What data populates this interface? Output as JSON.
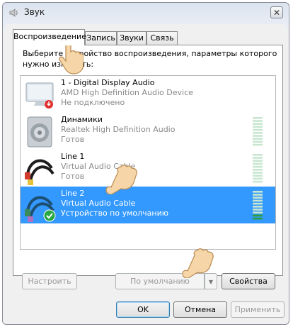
{
  "window": {
    "title": "Звук",
    "close_glyph": "✕"
  },
  "tabs": [
    {
      "label": "Воспроизведение",
      "active": true
    },
    {
      "label": "Запись",
      "active": false
    },
    {
      "label": "Звуки",
      "active": false
    },
    {
      "label": "Связь",
      "active": false
    }
  ],
  "description": "Выберите устройство воспроизведения, параметры которого нужно изменить:",
  "devices": [
    {
      "name": "1 - Digital Display Audio",
      "driver": "AMD High Definition Audio Device",
      "status": "Не подключено",
      "icon": "monitor-icon",
      "selected": false
    },
    {
      "name": "Динамики",
      "driver": "Realtek High Definition Audio",
      "status": "Готов",
      "icon": "speaker-icon",
      "selected": false
    },
    {
      "name": "Line 1",
      "driver": "Virtual Audio Cable",
      "status": "Готов",
      "icon": "audio-cable-icon",
      "selected": false
    },
    {
      "name": "Line 2",
      "driver": "Virtual Audio Cable",
      "status": "Устройство по умолчанию",
      "icon": "audio-cable-default-icon",
      "selected": true
    }
  ],
  "buttons": {
    "configure": "Настроить",
    "set_default": "По умолчанию",
    "properties": "Свойства",
    "ok": "OK",
    "cancel": "Отмена",
    "apply": "Применить"
  },
  "colors": {
    "selection": "#3399ff",
    "meter_idle": "#c8e6d0",
    "meter_active": "#2e9e3a"
  }
}
